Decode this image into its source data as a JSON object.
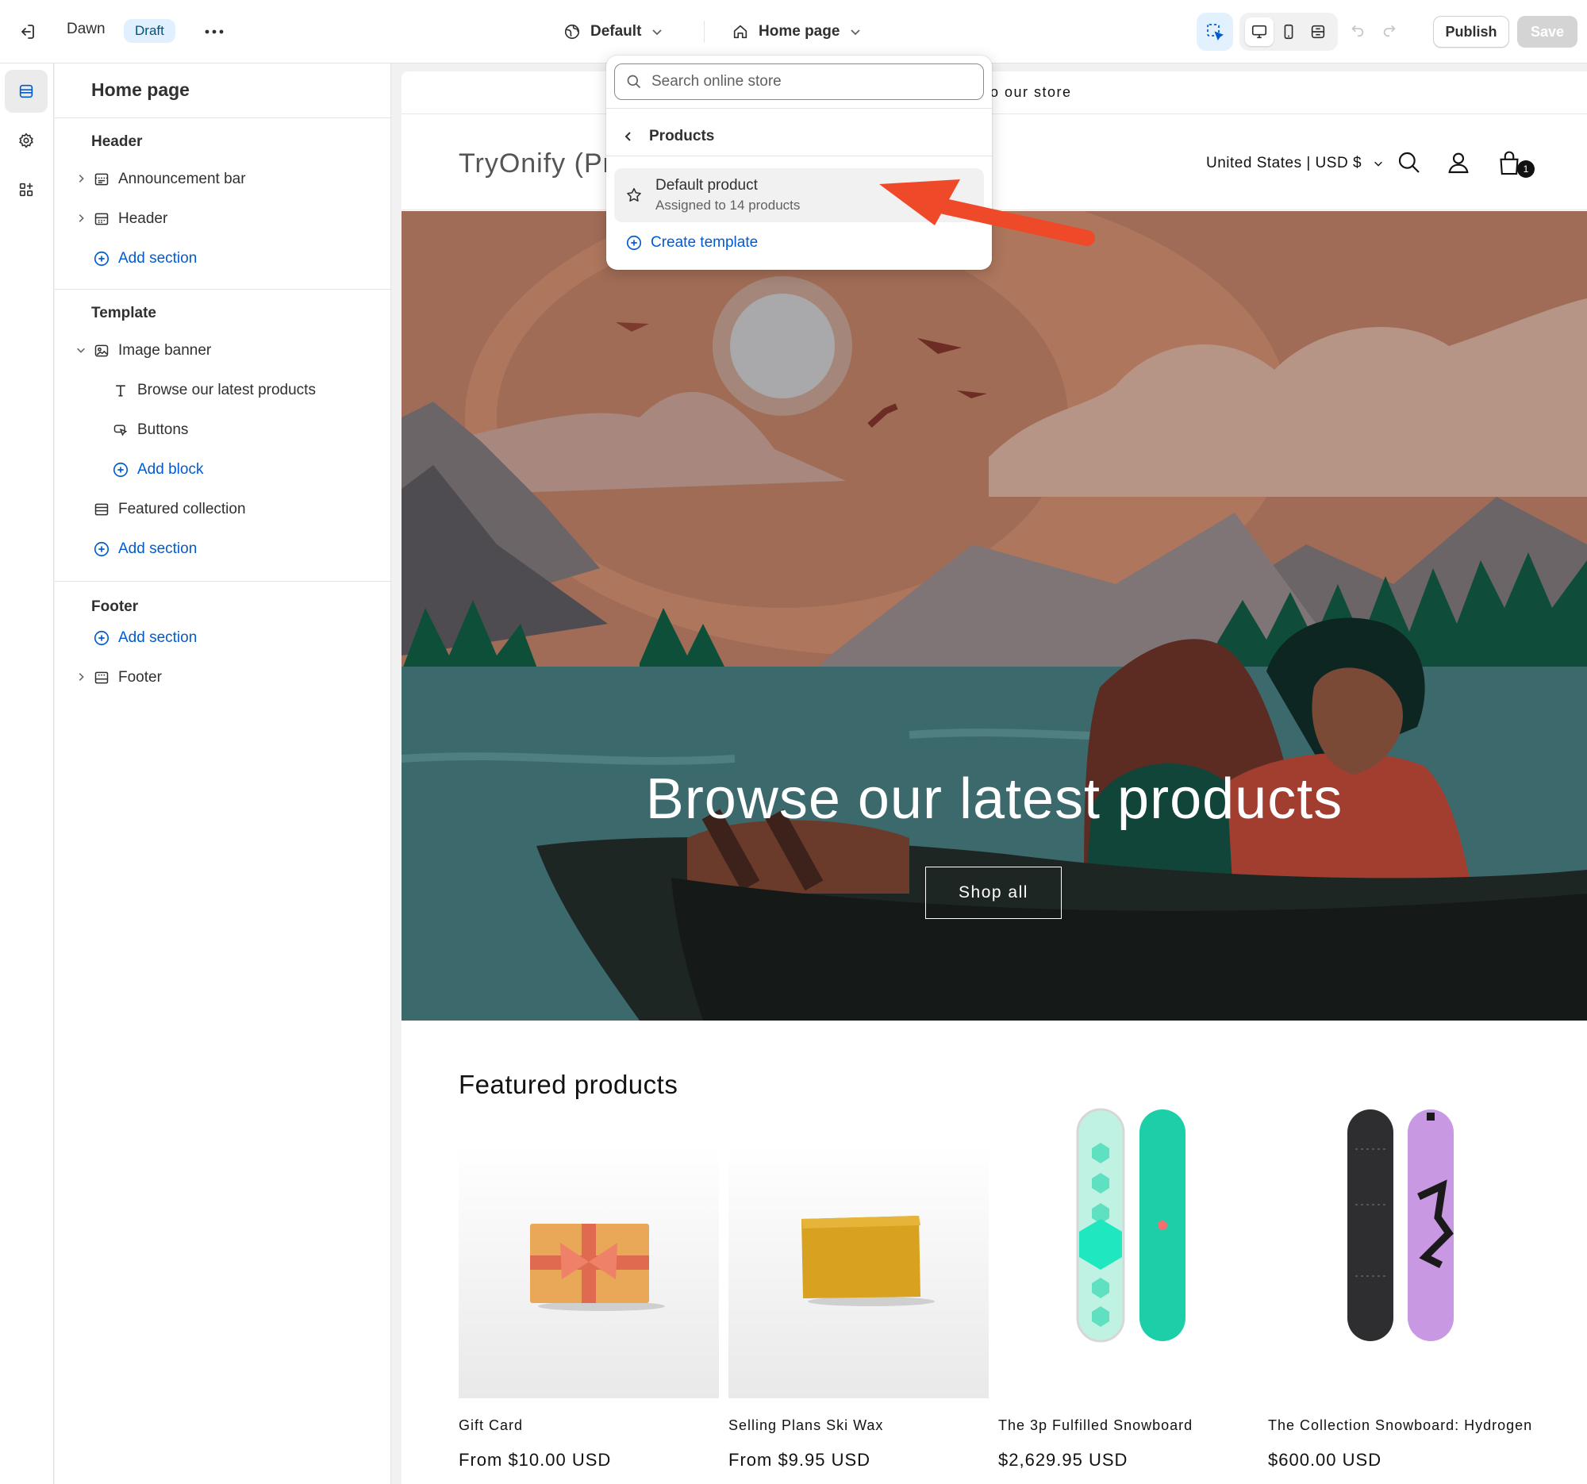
{
  "topbar": {
    "theme_name": "Dawn",
    "status_badge": "Draft",
    "theme_select": "Default",
    "page_select": "Home page",
    "publish_label": "Publish",
    "save_label": "Save"
  },
  "rail": {
    "items": [
      {
        "icon": "sections-icon",
        "active": true
      },
      {
        "icon": "settings-gear-icon",
        "active": false
      },
      {
        "icon": "apps-icon",
        "active": false
      }
    ]
  },
  "sidebar": {
    "title": "Home page",
    "header_group": {
      "label": "Header",
      "items": [
        "Announcement bar",
        "Header"
      ],
      "add_section": "Add section"
    },
    "template_group": {
      "label": "Template",
      "image_banner": "Image banner",
      "banner_blocks": [
        "Browse our latest products",
        "Buttons"
      ],
      "add_block": "Add block",
      "featured_collection": "Featured collection",
      "add_section": "Add section"
    },
    "footer_group": {
      "label": "Footer",
      "add_section": "Add section",
      "footer_item": "Footer"
    }
  },
  "dropdown": {
    "search_placeholder": "Search online store",
    "back_label": "Products",
    "item_title": "Default product",
    "item_subtitle": "Assigned to 14 products",
    "create_label": "Create template",
    "annotation_arrow_color": "#ee4a2a"
  },
  "preview": {
    "announcement": "o our store",
    "store_name": "TryOnify (Pro",
    "locale": "United States | USD $",
    "cart_count": "1",
    "hero": {
      "title": "Browse our latest products",
      "button": "Shop all"
    },
    "featured_title": "Featured products",
    "products": [
      {
        "name": "Gift Card",
        "price": "From $10.00 USD"
      },
      {
        "name": "Selling Plans Ski Wax",
        "price": "From $9.95 USD"
      },
      {
        "name": "The 3p Fulfilled Snowboard",
        "price": "$2,629.95 USD"
      },
      {
        "name": "The Collection Snowboard: Hydrogen",
        "price": "$600.00 USD"
      }
    ]
  },
  "colors": {
    "accent_link": "#005bd3",
    "draft_badge_bg": "#e0f0ff"
  }
}
